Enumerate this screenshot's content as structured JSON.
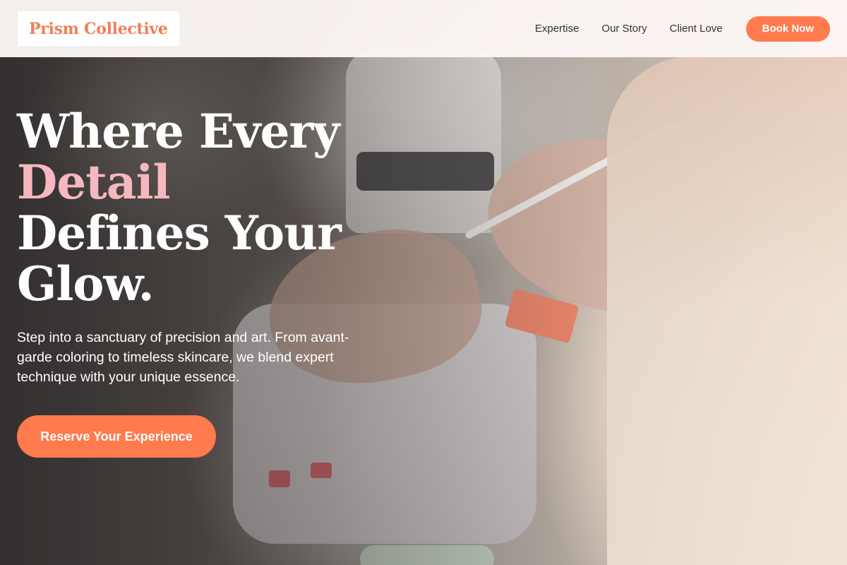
{
  "brand": {
    "name": "Prism Collective",
    "accent_color": "#ff7a4d",
    "logo_color": "#ef7f58"
  },
  "nav": {
    "links": [
      "Expertise",
      "Our Story",
      "Client Love"
    ],
    "cta_label": "Book Now"
  },
  "hero": {
    "title_line1": "Where Every",
    "title_accent": "Detail",
    "title_line3": "Defines Your",
    "title_line4": "Glow.",
    "accent_color": "#f6b8bf",
    "subtitle": "Step into a sanctuary of precision and art. From avant-garde coloring to timeless skincare, we blend expert technique with your unique essence.",
    "cta_label": "Reserve Your Experience",
    "background_description_icon": "manicure-photo"
  }
}
